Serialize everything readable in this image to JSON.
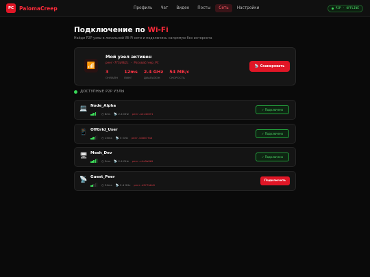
{
  "header": {
    "logo_mark": "PC",
    "logo_text": "PalomaCreep",
    "nav": [
      {
        "label": "Профиль",
        "active": false
      },
      {
        "label": "Чат",
        "active": false
      },
      {
        "label": "Видео",
        "active": false
      },
      {
        "label": "Посты",
        "active": false
      },
      {
        "label": "Сеть",
        "active": true
      },
      {
        "label": "Настройки",
        "active": false
      }
    ],
    "status": "P2P · OFFLINE"
  },
  "page": {
    "title_main": "Подключение по ",
    "title_accent": "Wi-Fi",
    "subtitle": "Найди P2P узлы в локальной Wi-Fi сети и подключись напрямую без интернета"
  },
  "node": {
    "title": "Мой узел активен",
    "id": "peer-7f3a9b2c · PalomaCreep_PC",
    "stats": [
      {
        "value": "3",
        "label": "ОНЛАЙН"
      },
      {
        "value": "12ms",
        "label": "ПИНГ"
      },
      {
        "value": "2.4 GHz",
        "label": "ДИАПАЗОН"
      },
      {
        "value": "54 МБ/с",
        "label": "СКОРОСТЬ"
      }
    ],
    "scan_label": "Сканировать"
  },
  "section_label": "ДОСТУПНЫЕ P2P УЗЛЫ",
  "peers": [
    {
      "icon": "laptop-icon",
      "glyph": "💻",
      "name": "Node_Alpha",
      "signal": 4,
      "ping": "8ms",
      "band": "2.4 GHz",
      "addr": "peer-a2c4e8f1",
      "action": "✓ Подключено",
      "connected": true
    },
    {
      "icon": "phone-icon",
      "glyph": "📱",
      "name": "OffGrid_User",
      "signal": 3,
      "ping": "15ms",
      "band": "5 GHz",
      "addr": "peer-b3d07fa0",
      "action": "✓ Подключено",
      "connected": true
    },
    {
      "icon": "mesh-router-icon",
      "glyph": "🖥",
      "name": "Mesh_Dev",
      "signal": 5,
      "ping": "5ms",
      "band": "2.4 GHz",
      "addr": "peer-c4e9a8b5",
      "action": "✓ Подключено",
      "connected": true
    },
    {
      "icon": "satellite-icon",
      "glyph": "📡",
      "name": "Guest_Peer",
      "signal": 2,
      "ping": "34ms",
      "band": "2.4 GHz",
      "addr": "peer-d5f7b6c8",
      "action": "Подключить",
      "connected": false
    }
  ]
}
